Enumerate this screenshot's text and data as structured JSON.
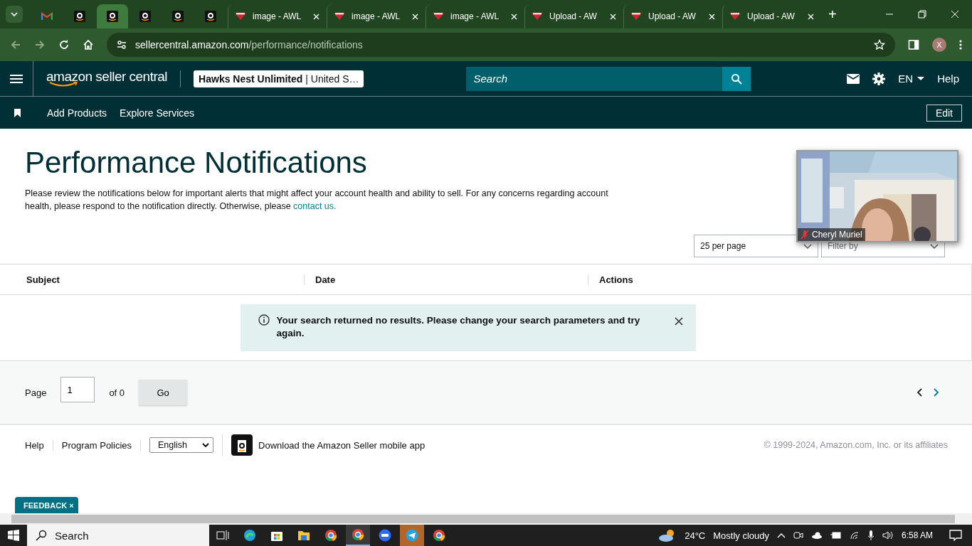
{
  "browser": {
    "tabs": [
      {
        "kind": "gmail",
        "selected": false
      },
      {
        "kind": "amazon",
        "selected": false
      },
      {
        "kind": "amazon",
        "selected": true
      },
      {
        "kind": "amazon",
        "selected": false
      },
      {
        "kind": "amazon",
        "selected": false
      },
      {
        "kind": "amazon",
        "selected": false
      },
      {
        "kind": "site",
        "title": "image - AWL",
        "selected": false
      },
      {
        "kind": "site",
        "title": "image - AWL",
        "selected": false
      },
      {
        "kind": "site",
        "title": "image - AWL",
        "selected": false
      },
      {
        "kind": "site",
        "title": "Upload - AW",
        "selected": false
      },
      {
        "kind": "site",
        "title": "Upload - AW",
        "selected": false
      },
      {
        "kind": "site",
        "title": "Upload - AW",
        "selected": false
      }
    ],
    "new_tab": "+",
    "profile": "X",
    "url_host": "sellercentral.amazon.com",
    "url_path": "/performance/notifications"
  },
  "header": {
    "logo": "amazon seller central",
    "account_name": "Hawks Nest Unlimited",
    "account_region": "| United S…",
    "search_placeholder": "Search",
    "language": "EN",
    "help": "Help"
  },
  "subnav": {
    "items": [
      "Add Products",
      "Explore Services"
    ],
    "edit": "Edit"
  },
  "page": {
    "title": "Performance Notifications",
    "intro": "Please review the notifications below for important alerts that might affect your account health and ability to sell. For any concerns regarding account health, please respond to the notification directly. Otherwise, please ",
    "intro_link": "contact us.",
    "per_page": "25 per page",
    "filter_placeholder": "Filter by"
  },
  "video": {
    "kind": "picture",
    "name": "Cheryl Muriel",
    "muted": true
  },
  "table": {
    "columns": [
      "Subject",
      "Date",
      "Actions"
    ],
    "message": "Your search returned no results. Please change your search parameters and try again."
  },
  "pagination": {
    "label": "Page",
    "value": "1",
    "of": "of 0",
    "go": "Go"
  },
  "footer": {
    "links": [
      "Help",
      "Program Policies"
    ],
    "language": "English",
    "app": "Download the Amazon Seller mobile app",
    "copyright": "© 1999-2024, Amazon.com, Inc. or its affiliates",
    "feedback": "FEEDBACK",
    "feedback_close": "×"
  },
  "taskbar": {
    "search": "Search",
    "temperature": "24°C",
    "weather": "Mostly cloudy",
    "time": "6:58 AM"
  }
}
